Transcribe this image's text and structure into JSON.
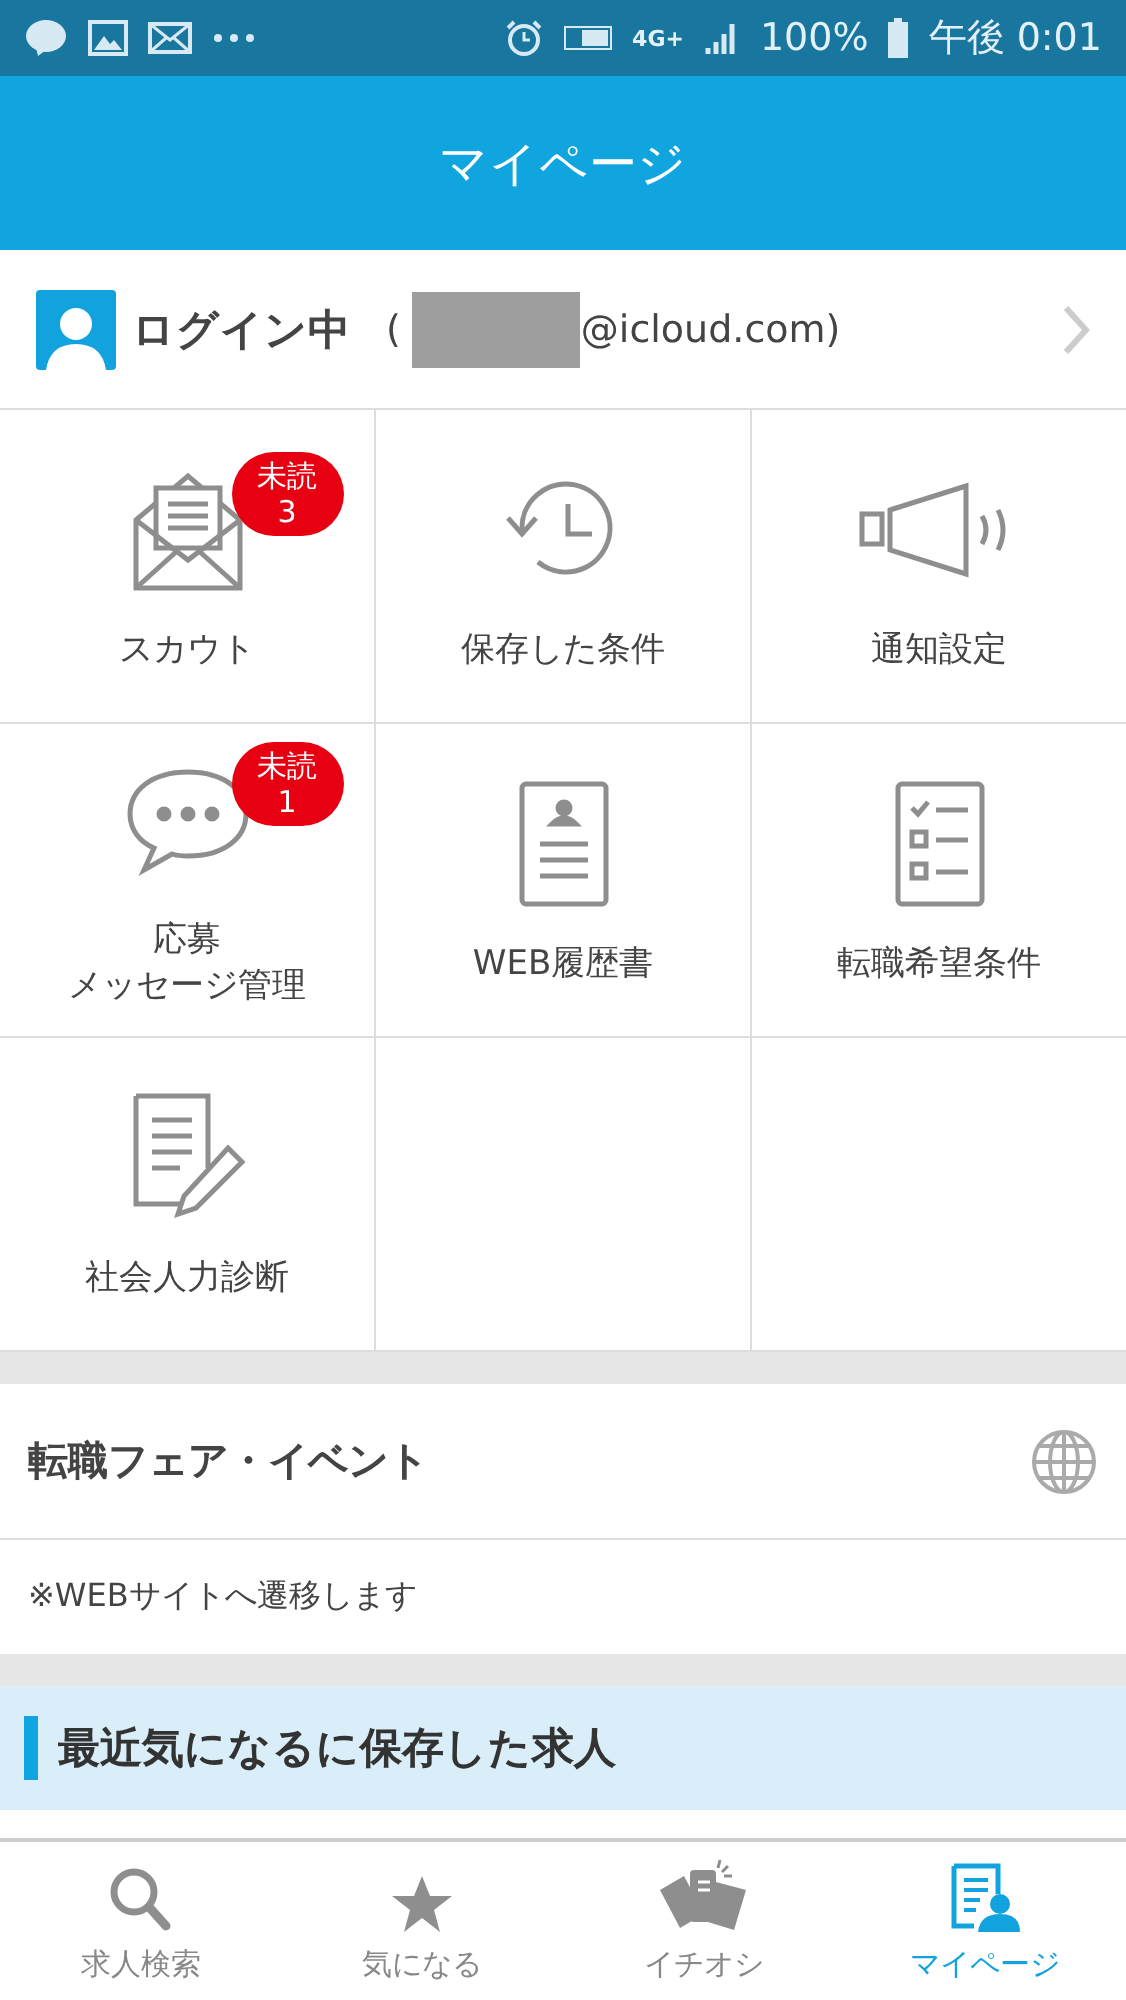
{
  "status_bar": {
    "network": "4G+",
    "battery": "100%",
    "time": "午後 0:01"
  },
  "header": {
    "title": "マイページ"
  },
  "login": {
    "status": "ログイン中",
    "email_prefix": "(",
    "email_suffix": "@icloud.com)"
  },
  "menu": [
    {
      "kind": "mail",
      "lines": [
        "スカウト"
      ],
      "badge": {
        "label": "未読",
        "count": "3"
      }
    },
    {
      "kind": "history",
      "lines": [
        "保存した条件"
      ]
    },
    {
      "kind": "speaker",
      "lines": [
        "通知設定"
      ]
    },
    {
      "kind": "chat",
      "lines": [
        "応募",
        "メッセージ管理"
      ],
      "badge": {
        "label": "未読",
        "count": "1"
      }
    },
    {
      "kind": "resume",
      "lines": [
        "WEB履歴書"
      ]
    },
    {
      "kind": "checklist",
      "lines": [
        "転職希望条件"
      ]
    },
    {
      "kind": "pencil",
      "lines": [
        "社会人力診断"
      ]
    }
  ],
  "fair": {
    "title": "転職フェア・イベント",
    "note": "※WEBサイトへ遷移します"
  },
  "saved_section": {
    "title": "最近気になるに保存した求人"
  },
  "tabs": [
    {
      "kind": "search",
      "label": "求人検索",
      "selected": false
    },
    {
      "kind": "star",
      "label": "気になる",
      "selected": false
    },
    {
      "kind": "cards",
      "label": "イチオシ",
      "selected": false
    },
    {
      "kind": "mypage",
      "label": "マイページ",
      "selected": true
    }
  ]
}
